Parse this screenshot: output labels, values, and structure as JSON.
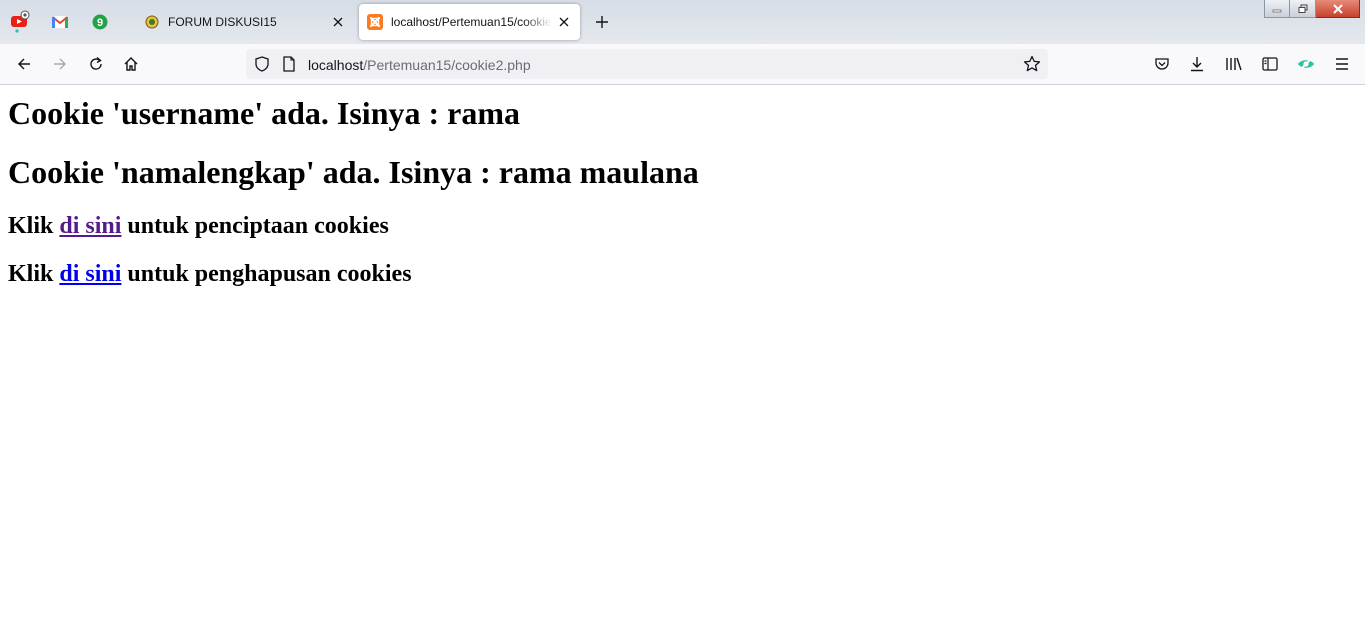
{
  "browser": {
    "tabs": [
      {
        "title": "FORUM DISKUSI15",
        "active": false,
        "icon": "forum-crest-icon"
      },
      {
        "title": "localhost/Pertemuan15/cookie2.php",
        "active": true,
        "icon": "xampp-icon"
      }
    ],
    "pinned_tabs": [
      {
        "icon": "youtube-notification-icon"
      },
      {
        "icon": "gmail-icon"
      },
      {
        "icon": "green-badge-icon",
        "badge": "9"
      }
    ],
    "url": {
      "host": "localhost",
      "path": "/Pertemuan15/cookie2.php"
    },
    "colors": {
      "accent_green": "#2ac3a2",
      "visited_link": "#551a8b",
      "link": "#0000ee"
    }
  },
  "page": {
    "heading_1": "Cookie 'username' ada. Isinya : rama",
    "heading_2": "Cookie 'namalengkap' ada. Isinya : rama maulana",
    "line_create": {
      "prefix": "Klik ",
      "link": "di sini",
      "suffix": " untuk penciptaan cookies"
    },
    "line_delete": {
      "prefix": "Klik ",
      "link": "di sini",
      "suffix": " untuk penghapusan cookies"
    }
  }
}
